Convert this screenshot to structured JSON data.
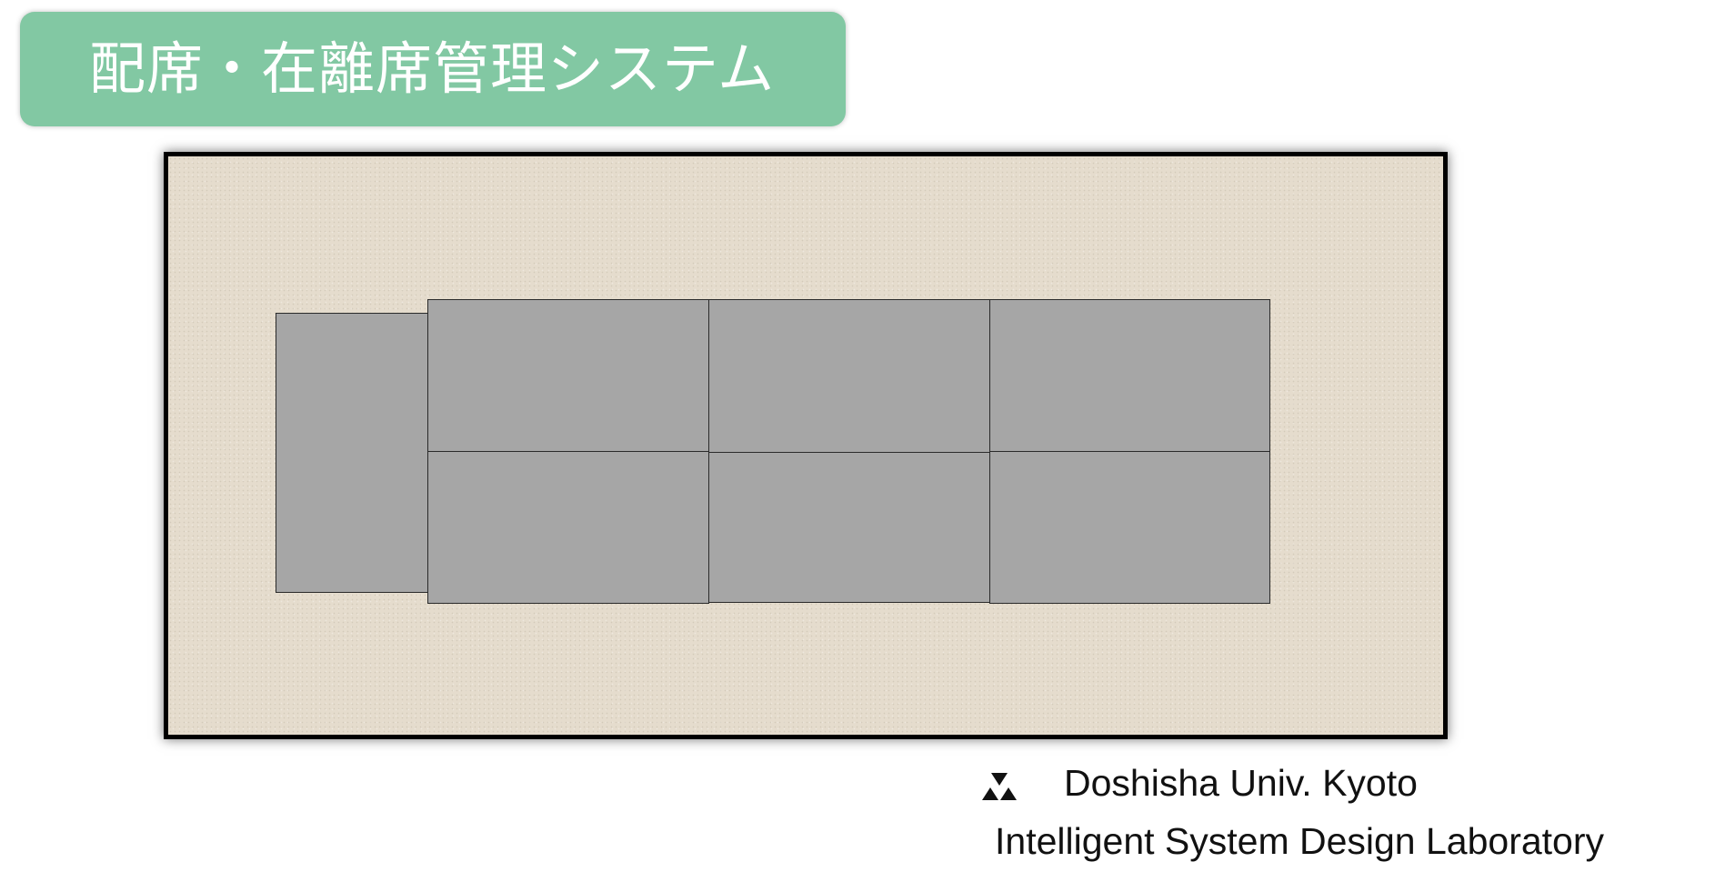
{
  "header": {
    "title": "配席・在離席管理システム",
    "banner_color": "#82c8a3"
  },
  "floor_plan": {
    "background_color": "#e5dccd",
    "border_color": "#000000",
    "desk_color": "#a6a6a6",
    "desk_count": 7
  },
  "footer": {
    "logo_icon": "doshisha-trefoil-icon",
    "university": "Doshisha Univ. Kyoto",
    "lab": "Intelligent System Design Laboratory"
  }
}
